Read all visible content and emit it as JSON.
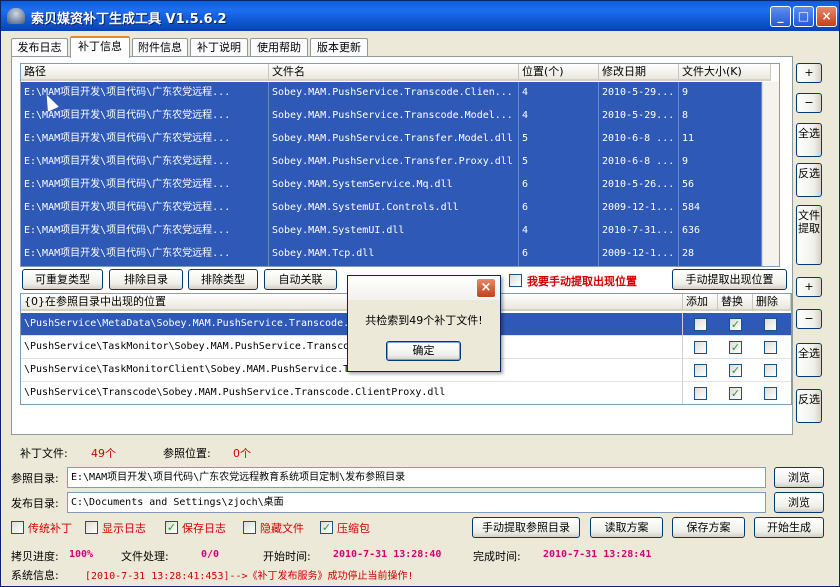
{
  "window": {
    "title": "索贝媒资补丁生成工具 V1.5.6.2",
    "min_glyph": "_",
    "max_glyph": "□",
    "close_glyph": "×"
  },
  "tabs": [
    "发布日志",
    "补丁信息",
    "附件信息",
    "补丁说明",
    "使用帮助",
    "版本更新"
  ],
  "active_tab": 1,
  "files_grid": {
    "columns": [
      "路径",
      "文件名",
      "位置(个)",
      "修改日期",
      "文件大小(K)"
    ],
    "rows": [
      [
        "E:\\MAM项目开发\\项目代码\\广东农党远程...",
        "Sobey.MAM.PushService.Transcode.Clien...",
        "4",
        "2010-5-29...",
        "9"
      ],
      [
        "E:\\MAM项目开发\\项目代码\\广东农党远程...",
        "Sobey.MAM.PushService.Transcode.Model...",
        "4",
        "2010-5-29...",
        "8"
      ],
      [
        "E:\\MAM项目开发\\项目代码\\广东农党远程...",
        "Sobey.MAM.PushService.Transfer.Model.dll",
        "5",
        "2010-6-8 ...",
        "11"
      ],
      [
        "E:\\MAM项目开发\\项目代码\\广东农党远程...",
        "Sobey.MAM.PushService.Transfer.Proxy.dll",
        "5",
        "2010-6-8 ...",
        "9"
      ],
      [
        "E:\\MAM项目开发\\项目代码\\广东农党远程...",
        "Sobey.MAM.SystemService.Mq.dll",
        "6",
        "2010-5-26...",
        "56"
      ],
      [
        "E:\\MAM项目开发\\项目代码\\广东农党远程...",
        "Sobey.MAM.SystemUI.Controls.dll",
        "6",
        "2009-12-1...",
        "584"
      ],
      [
        "E:\\MAM项目开发\\项目代码\\广东农党远程...",
        "Sobey.MAM.SystemUI.dll",
        "4",
        "2010-7-31...",
        "636"
      ],
      [
        "E:\\MAM项目开发\\项目代码\\广东农党远程...",
        "Sobey.MAM.Tcp.dll",
        "6",
        "2009-12-1...",
        "28"
      ]
    ]
  },
  "side_buttons_top": {
    "add": "+",
    "remove": "−",
    "select_all": "全选",
    "invert": "反选",
    "manual_extract": "文件提取"
  },
  "mid_buttons": {
    "repeatable_type": "可重复类型",
    "exclude_dir": "排除目录",
    "exclude_type": "排除类型",
    "auto_link": "自动关联",
    "manual_check_label": "我要手动提取出现位置",
    "manual_extract_pos": "手动提取出现位置"
  },
  "positions_grid": {
    "columns": [
      "{0}在参照目录中出现的位置",
      "添加",
      "替换",
      "删除"
    ],
    "rows": [
      {
        "path": "\\PushService\\MetaData\\Sobey.MAM.PushService.Transcode.",
        "add": false,
        "replace": true,
        "delete": false
      },
      {
        "path": "\\PushService\\TaskMonitor\\Sobey.MAM.PushService.Transco",
        "add": false,
        "replace": true,
        "delete": false
      },
      {
        "path": "\\PushService\\TaskMonitorClient\\Sobey.MAM.PushService.T",
        "add": false,
        "replace": true,
        "delete": false
      },
      {
        "path": "\\PushService\\Transcode\\Sobey.MAM.PushService.Transcode.ClientProxy.dll",
        "add": false,
        "replace": true,
        "delete": false
      }
    ]
  },
  "side_buttons_bottom": {
    "add": "+",
    "remove": "−",
    "select_all": "全选",
    "invert": "反选"
  },
  "counts": {
    "patch_files_label": "补丁文件:",
    "patch_files_value": "49个",
    "ref_pos_label": "参照位置:",
    "ref_pos_value": "0个"
  },
  "paths": {
    "ref_label": "参照目录:",
    "ref_value": "E:\\MAM项目开发\\项目代码\\广东农党远程教育系统项目定制\\发布参照目录",
    "pub_label": "发布目录:",
    "pub_value": "C:\\Documents and Settings\\zjoch\\桌面",
    "browse": "浏览"
  },
  "options": [
    {
      "label": "传统补丁",
      "checked": false
    },
    {
      "label": "显示日志",
      "checked": false
    },
    {
      "label": "保存日志",
      "checked": true
    },
    {
      "label": "隐藏文件",
      "checked": false
    },
    {
      "label": "压缩包",
      "checked": true
    }
  ],
  "action_buttons": {
    "manual_ref": "手动提取参照目录",
    "read_scheme": "读取方案",
    "save_scheme": "保存方案",
    "start": "开始生成"
  },
  "status": {
    "copy_label": "拷贝进度:",
    "copy_value": "100%",
    "file_label": "文件处理:",
    "file_value": "0/0",
    "start_label": "开始时间:",
    "start_value": "2010-7-31 13:28:40",
    "end_label": "完成时间:",
    "end_value": "2010-7-31 13:28:41",
    "sys_label": "系统信息:",
    "sys_value": "[2010-7-31 13:28:41:453]-->《补丁发布服务》成功停止当前操作!"
  },
  "dialog": {
    "message": "共检索到49个补丁文件!",
    "ok": "确定",
    "close_glyph": "×"
  },
  "colors": {
    "selection": "#2f59b7",
    "title_bar": "#0b4fc8",
    "red_text": "#d40000",
    "magenta_text": "#d4007a",
    "check_green": "#21a121"
  }
}
